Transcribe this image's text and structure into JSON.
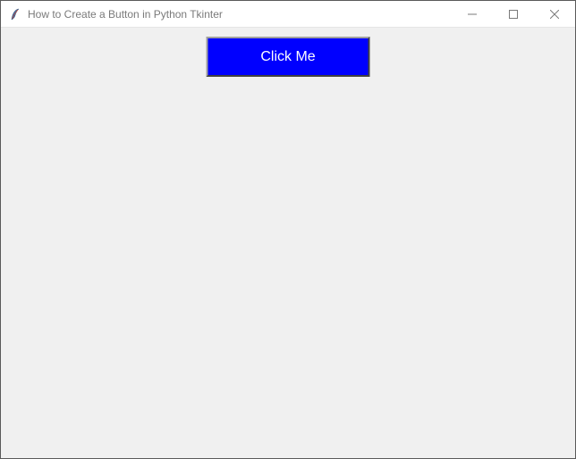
{
  "window": {
    "title": "How to Create a Button in Python Tkinter",
    "icon": "tkinter-feather-icon"
  },
  "controls": {
    "minimize": "minimize",
    "maximize": "maximize",
    "close": "close"
  },
  "button": {
    "label": "Click Me",
    "bg_color": "#0000ff",
    "fg_color": "#ffffff"
  }
}
